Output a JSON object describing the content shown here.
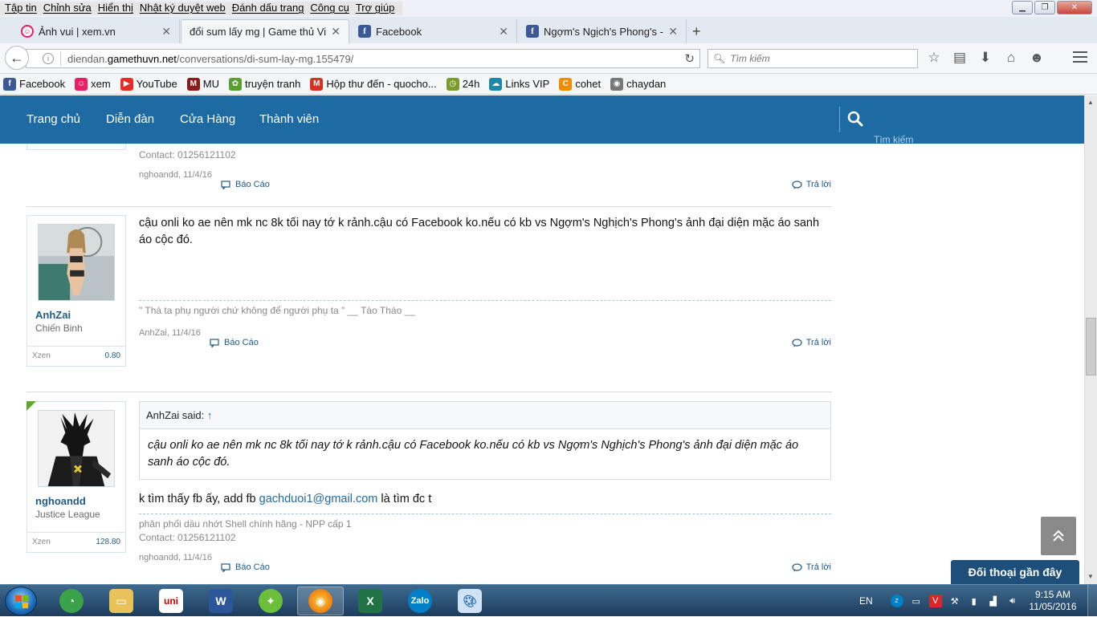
{
  "browser": {
    "menu": [
      "Tập tin",
      "Chỉnh sửa",
      "Hiển thị",
      "Nhật ký duyệt web",
      "Đánh dấu trang",
      "Công cụ",
      "Trợ giúp"
    ],
    "tabs": [
      {
        "title": "Ảnh vui | xem.vn",
        "icon": "xem-icon"
      },
      {
        "title": "đổi sum lấy mg | Game thủ Việ...",
        "icon": "gamethu-icon"
      },
      {
        "title": "Facebook",
        "icon": "facebook-icon"
      },
      {
        "title": "Ngợm's Ngịch's Phong's - ...",
        "icon": "facebook-icon"
      }
    ],
    "url": {
      "pre": "diendan.",
      "domain": "gamethuvn.net",
      "path": "/conversations/di-sum-lay-mg.155479/"
    },
    "search_placeholder": "Tìm kiếm",
    "bookmarks": [
      {
        "label": "Facebook",
        "color": "#3b5998",
        "glyph": "f"
      },
      {
        "label": "xem",
        "color": "#e91e63",
        "glyph": "☺"
      },
      {
        "label": "YouTube",
        "color": "#e52d27",
        "glyph": "▶"
      },
      {
        "label": "MU",
        "color": "#8b1a1a",
        "glyph": "M"
      },
      {
        "label": "truyện tranh",
        "color": "#5a9e2f",
        "glyph": "✿"
      },
      {
        "label": "Hộp thư đến - quocho...",
        "color": "#d93025",
        "glyph": "M"
      },
      {
        "label": "24h",
        "color": "#7a9a2a",
        "glyph": "◷"
      },
      {
        "label": "Links VIP",
        "color": "#1e88a8",
        "glyph": "☁"
      },
      {
        "label": "cohet",
        "color": "#f08c00",
        "glyph": "C"
      },
      {
        "label": "chaydan",
        "color": "#777777",
        "glyph": "◉"
      }
    ]
  },
  "site": {
    "nav": [
      "Trang chủ",
      "Diễn đàn",
      "Cửa Hàng",
      "Thành viên"
    ],
    "search_label": "Tìm kiếm",
    "accent": "#1e6aa3"
  },
  "messages": [
    {
      "contact": "Contact: 01256121102",
      "author": "nghoandd",
      "date": "11/4/16",
      "report": "Báo Cáo",
      "reply": "Trả lời"
    },
    {
      "author": "AnhZai",
      "user_title": "Chiến Binh",
      "xzen_label": "Xzen",
      "xzen_value": "0.80",
      "body": "cậu onli ko ae nên mk nc 8k tối nay tớ k rảnh.cậu có Facebook ko.nếu có kb vs Ngợm's Nghịch's Phong's ảnh đại diện mặc áo sanh áo cộc đó.",
      "signature": "\" Thà ta phụ người chứ không để người phụ ta \" __ Tào Tháo __",
      "date": "11/4/16",
      "report": "Báo Cáo",
      "reply": "Trả lời"
    },
    {
      "author": "nghoandd",
      "user_title": "Justice League",
      "xzen_label": "Xzen",
      "xzen_value": "128.80",
      "quote_author": "AnhZai said:",
      "quote_arrow": "↑",
      "quote_body": "cậu onli ko ae nên mk nc 8k tối nay tớ k rảnh.cậu có Facebook ko.nếu có kb vs Ngợm's Nghịch's Phong's ảnh đại diện mặc áo sanh áo cộc đó.",
      "body_pre": "k tìm thấy fb ấy, add fb",
      "body_link": "gachduoi1@gmail.com",
      "body_post": "là tìm đc t",
      "signature_line1": "phân phối dầu nhớt Shell chính hãng - NPP cấp 1",
      "signature_line2": "Contact: 01256121102",
      "date": "11/4/16",
      "report": "Báo Cáo",
      "reply": "Trả lời"
    }
  ],
  "floating": {
    "recent_chats": "Đối thoại gần đây"
  },
  "taskbar": {
    "lang": "EN",
    "time": "9:15 AM",
    "date": "11/05/2016"
  }
}
